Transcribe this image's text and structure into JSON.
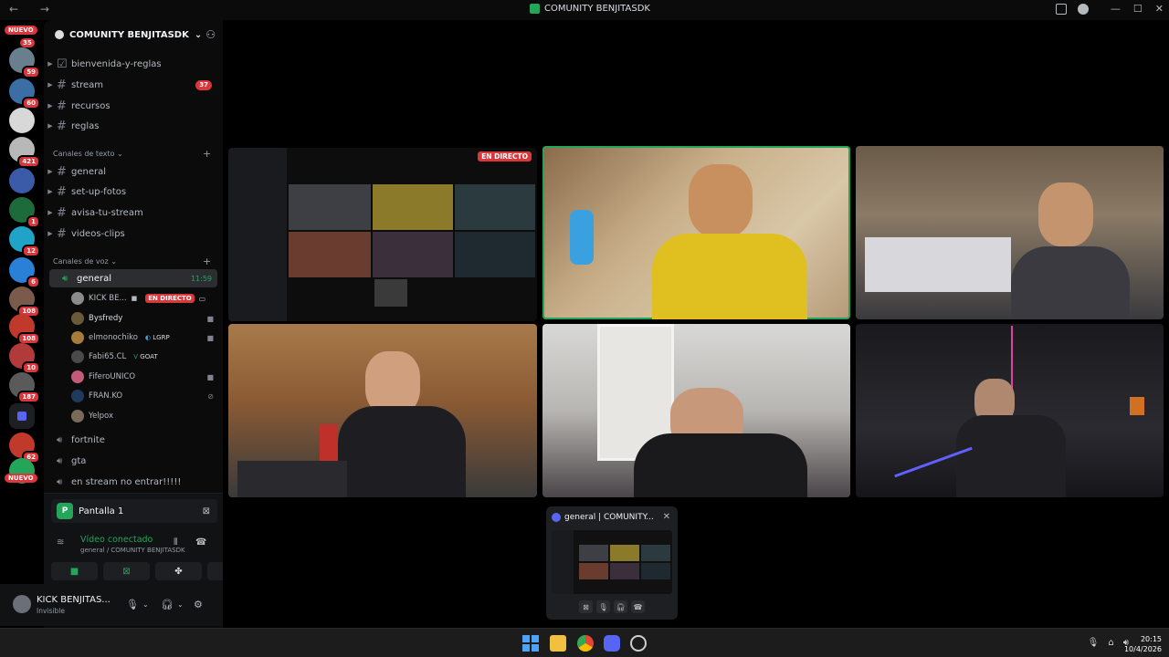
{
  "window": {
    "title": "COMUNITY BENJITASDK",
    "back": "←",
    "forward": "→",
    "minimize": "—",
    "maximize": "☐",
    "close": "✕"
  },
  "servers": {
    "nuevo_top": "NUEVO",
    "nuevo_bottom": "NUEVO",
    "badges": [
      "35",
      "59",
      "60",
      "421",
      "1",
      "12",
      "6",
      "108",
      "108",
      "10",
      "187",
      "62"
    ]
  },
  "guild": {
    "name": "COMUNITY BENJITASDK",
    "chevron": "⌄"
  },
  "text_channels_top": [
    {
      "name": "bienvenida-y-reglas",
      "count": ""
    },
    {
      "name": "stream",
      "count": "37"
    },
    {
      "name": "recursos",
      "count": ""
    },
    {
      "name": "reglas",
      "count": ""
    }
  ],
  "category_text": "Canales de texto",
  "text_channels": [
    {
      "name": "general"
    },
    {
      "name": "set-up-fotos"
    },
    {
      "name": "avisa-tu-stream"
    },
    {
      "name": "videos-clips"
    }
  ],
  "category_voice": "Canales de voz",
  "voice_general": {
    "name": "general",
    "time": "11:59"
  },
  "voice_users": [
    {
      "name": "KICK BE...",
      "live": "EN DIRECTO",
      "tag": "",
      "color": "#8b8b8b"
    },
    {
      "name": "Bysfredy",
      "live": "",
      "tag": "",
      "color": "#6b5a3a"
    },
    {
      "name": "elmonochiko",
      "live": "",
      "tag": "LGRP",
      "color": "#a67c3a"
    },
    {
      "name": "Fabi65.CL",
      "live": "",
      "tag": "GOAT",
      "color": "#4a4a4a"
    },
    {
      "name": "FiferoUNICO",
      "live": "",
      "tag": "",
      "color": "#c45a7a"
    },
    {
      "name": "FRAN.KO",
      "live": "",
      "tag": "",
      "color": "#1f3a5a"
    },
    {
      "name": "Yelpox",
      "live": "",
      "tag": "",
      "color": "#7a6a5a"
    }
  ],
  "voice_channels": [
    {
      "name": "fortnite"
    },
    {
      "name": "gta"
    },
    {
      "name": "en stream no entrar!!!!!"
    }
  ],
  "voice_panel": {
    "sharing": "Pantalla 1",
    "status": "Vídeo conectado",
    "location": "general / COMUNITY BENJITASDK"
  },
  "user": {
    "name": "KICK BENJITAS...",
    "status": "Invisible"
  },
  "stage": {
    "live_badge": "EN DIRECTO"
  },
  "pip": {
    "title": "general | COMUNITY..."
  },
  "clock": {
    "time": "20:15",
    "date": "10/4/2026"
  },
  "colors": {
    "green": "#23a55a",
    "red": "#da373c",
    "blurple": "#5865f2"
  }
}
